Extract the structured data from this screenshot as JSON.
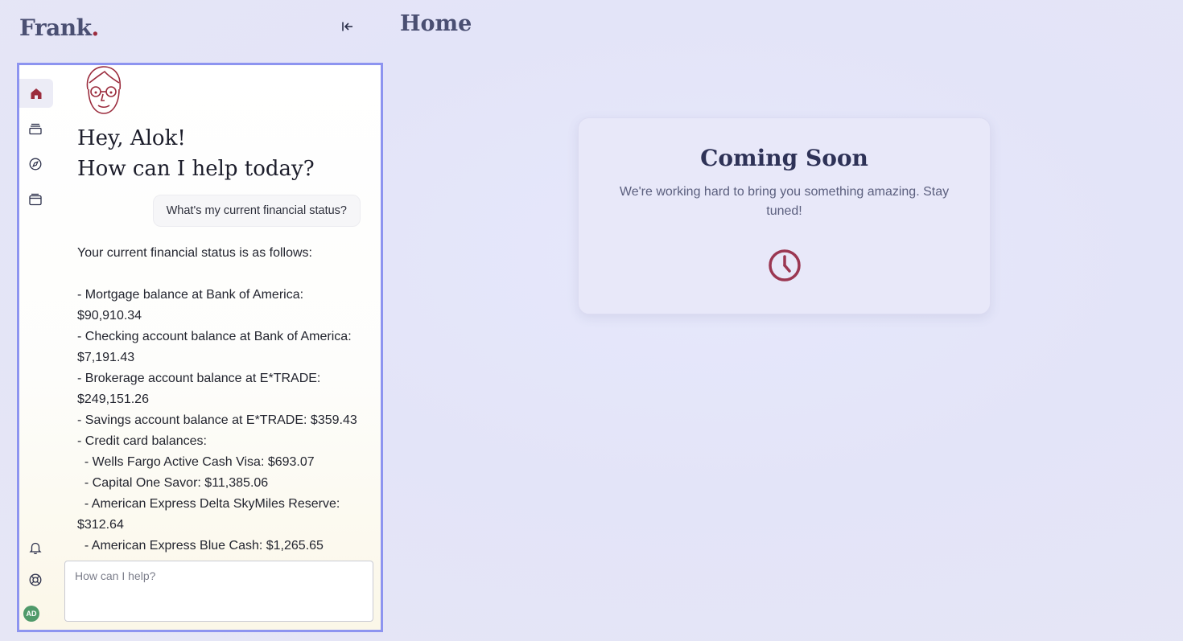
{
  "app": {
    "logo_text": "Frank",
    "logo_dot": "."
  },
  "header": {
    "page_title": "Home",
    "collapse_icon": "collapse-left-icon"
  },
  "sidebar": {
    "items": [
      {
        "name": "home",
        "icon": "home-icon",
        "active": true
      },
      {
        "name": "accounts",
        "icon": "stack-icon",
        "active": false
      },
      {
        "name": "explore",
        "icon": "compass-icon",
        "active": false
      },
      {
        "name": "wallet",
        "icon": "wallet-icon",
        "active": false
      }
    ],
    "bottom": [
      {
        "name": "notifications",
        "icon": "bell-icon"
      },
      {
        "name": "help",
        "icon": "lifebuoy-icon"
      }
    ],
    "avatar_initials": "AD"
  },
  "chat": {
    "greeting_line1": "Hey, Alok!",
    "greeting_line2": "How can I help today?",
    "user_message": "What's my current financial status?",
    "assistant_lines": [
      "Your current financial status is as follows:",
      "",
      "- Mortgage balance at Bank of America: $90,910.34",
      "- Checking account balance at Bank of America: $7,191.43",
      "- Brokerage account balance at E*TRADE: $249,151.26",
      "- Savings account balance at E*TRADE: $359.43",
      "- Credit card balances:",
      "  - Wells Fargo Active Cash Visa: $693.07",
      "  - Capital One Savor: $11,385.06",
      "  - American Express Delta SkyMiles Reserve: $312.64",
      "  - American Express Blue Cash: $1,265.65"
    ],
    "input_placeholder": "How can I help?"
  },
  "main": {
    "card_title": "Coming Soon",
    "card_text": "We're working hard to bring you something amazing. Stay tuned!",
    "card_icon": "clock-icon"
  },
  "colors": {
    "brand": "#4a4f72",
    "accent": "#9b2c3d",
    "panel_border": "#8d94f0",
    "avatar_bg": "#4f9a6a"
  }
}
